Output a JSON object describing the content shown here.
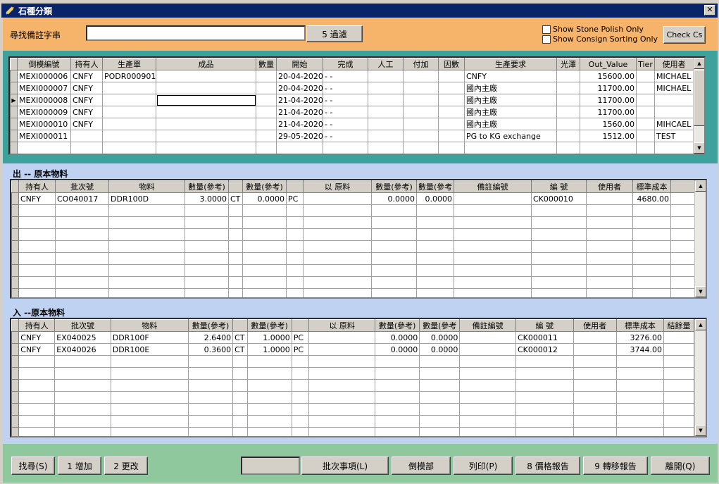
{
  "window": {
    "title": "石種分類",
    "close_glyph": "✕",
    "icon": "diamond-tool-icon"
  },
  "search": {
    "label": "尋找備註字串",
    "value": "",
    "filter_button": "5 過濾",
    "show_stone_polish_only": "Show Stone Polish Only",
    "show_consign_sorting_only": "Show Consign Sorting Only",
    "check_button": "Check Cs"
  },
  "top_grid": {
    "headers": [
      "倒模編號",
      "持有人",
      "生產單",
      "成品",
      "數量",
      "開始",
      "完成",
      "人工",
      "付加",
      "因數",
      "生產要求",
      "光澤",
      "Out_Value",
      "Tier",
      "使用者"
    ],
    "rows": [
      [
        "MEXI000006",
        "CNFY",
        "PODR000901",
        "",
        "",
        "20-04-2020",
        "- -",
        "",
        "",
        "",
        "CNFY",
        "",
        "15600.00",
        "",
        "MICHAEL"
      ],
      [
        "MEXI000007",
        "CNFY",
        "",
        "",
        "",
        "20-04-2020",
        "- -",
        "",
        "",
        "",
        "國內主廠",
        "",
        "11700.00",
        "",
        "MICHAEL"
      ],
      [
        "MEXI000008",
        "CNFY",
        "",
        "",
        "",
        "21-04-2020",
        "- -",
        "",
        "",
        "",
        "國內主廠",
        "",
        "11700.00",
        "",
        ""
      ],
      [
        "MEXI000009",
        "CNFY",
        "",
        "",
        "",
        "21-04-2020",
        "- -",
        "",
        "",
        "",
        "國內主廠",
        "",
        "11700.00",
        "",
        ""
      ],
      [
        "MEXI000010",
        "CNFY",
        "",
        "",
        "",
        "21-04-2020",
        "- -",
        "",
        "",
        "",
        "國內主廠",
        "",
        "1560.00",
        "",
        "MIHCAEL"
      ],
      [
        "MEXI000011",
        "",
        "",
        "",
        "",
        "29-05-2020",
        "- -",
        "",
        "",
        "",
        "PG to KG exchange",
        "",
        "1512.00",
        "",
        "TEST"
      ],
      [
        "",
        "",
        "",
        "",
        "",
        "",
        "",
        "",
        "",
        "",
        "",
        "",
        "",
        "",
        ""
      ]
    ],
    "current_row_marker": "▶"
  },
  "out_section": {
    "label": "出 -- 原本物料",
    "headers": [
      "持有人",
      "批次號",
      "物料",
      "數量(參考)",
      "",
      "數量(參考)",
      "",
      "以 原料",
      "數量(參考)",
      "數量(參考",
      "備註編號",
      "編 號",
      "使用者",
      "標準成本",
      ""
    ],
    "rows": [
      [
        "CNFY",
        "CO040017",
        "DDR100D",
        "3.0000",
        "CT",
        "0.0000",
        "PC",
        "",
        "0.0000",
        "0.0000",
        "",
        "CK000010",
        "",
        "4680.00",
        ""
      ]
    ]
  },
  "in_section": {
    "label": "入 --原本物料",
    "headers": [
      "持有人",
      "批次號",
      "物料",
      "數量(參考)",
      "",
      "數量(參考)",
      "",
      "以 原料",
      "數量(參考)",
      "數量(參考",
      "備註編號",
      "編 號",
      "使用者",
      "標準成本",
      "結餘量"
    ],
    "rows": [
      [
        "CNFY",
        "EX040025",
        "DDR100F",
        "2.6400",
        "CT",
        "1.0000",
        "PC",
        "",
        "0.0000",
        "0.0000",
        "",
        "CK000011",
        "",
        "3276.00",
        ""
      ],
      [
        "CNFY",
        "EX040026",
        "DDR100E",
        "0.3600",
        "CT",
        "1.0000",
        "PC",
        "",
        "0.0000",
        "0.0000",
        "",
        "CK000012",
        "",
        "3744.00",
        ""
      ]
    ]
  },
  "footer": {
    "find": "找尋(S)",
    "add": "1 增加",
    "edit": "2 更改",
    "batch_items": "批次事項(L)",
    "mold_dept": "倒模部",
    "print": "列印(P)",
    "price_report": "8 價格報告",
    "transfer_report": "9 轉移報告",
    "exit": "離開(Q)"
  },
  "colors": {
    "title_bar": "#0a246a",
    "search_panel": "#f6b36a",
    "top_panel": "#3fa19c",
    "mid_panel": "#bfd2f2",
    "bottom_bar": "#8fc89d"
  }
}
